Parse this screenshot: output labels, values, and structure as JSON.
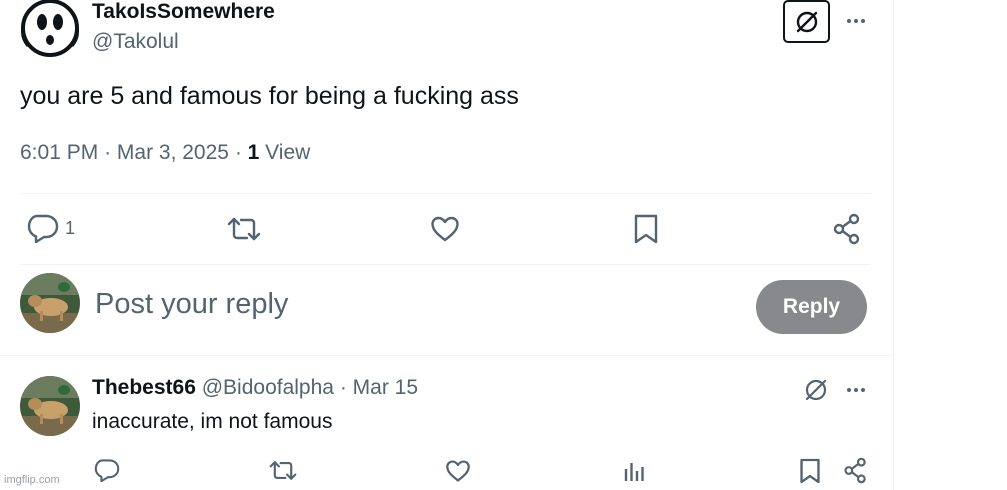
{
  "tweet": {
    "author_name": "TakoIsSomewhere",
    "author_handle": "@Takolul",
    "text": "you are 5 and famous for being a fucking ass",
    "time": "6:01 PM",
    "date": "Mar 3, 2025",
    "views_count": "1",
    "views_label": "View",
    "reply_count": "1"
  },
  "reply_box": {
    "placeholder": "Post your reply",
    "button_label": "Reply"
  },
  "comment": {
    "author_name": "Thebest66",
    "author_handle": "@Bidoofalpha",
    "separator": "·",
    "date": "Mar 15",
    "text": "inaccurate, im not famous"
  },
  "watermark": "imgflip.com",
  "icons": {
    "grok": "grok-icon",
    "more": "more-icon",
    "reply": "reply-icon",
    "retweet": "retweet-icon",
    "like": "like-icon",
    "bookmark": "bookmark-icon",
    "share": "share-icon",
    "analytics": "analytics-icon"
  },
  "colors": {
    "text_primary": "#0f1419",
    "text_secondary": "#536471",
    "reply_button_bg": "#87898c",
    "divider": "#eff3f4"
  }
}
